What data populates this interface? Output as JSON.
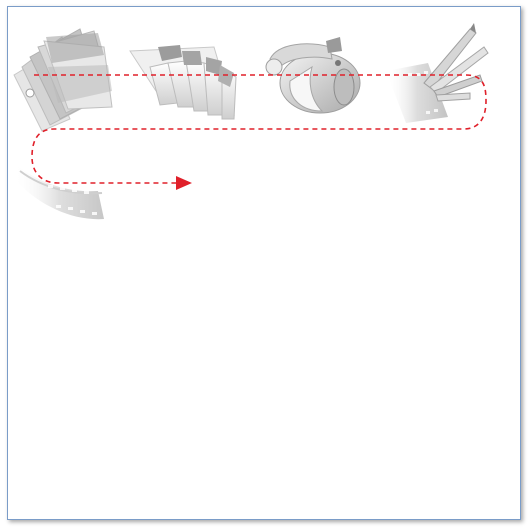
{
  "canvas": {
    "border_color": "#7a9cc8",
    "background": "#ffffff"
  },
  "thumbnails": [
    {
      "name": "color-swatch-fan-icon"
    },
    {
      "name": "piano-keys-icon"
    },
    {
      "name": "cartoon-camera-icon"
    },
    {
      "name": "pencils-film-icon"
    },
    {
      "name": "film-strip-icon"
    }
  ],
  "path": {
    "color": "#e0202a",
    "style": "dashed",
    "arrow": "right"
  }
}
